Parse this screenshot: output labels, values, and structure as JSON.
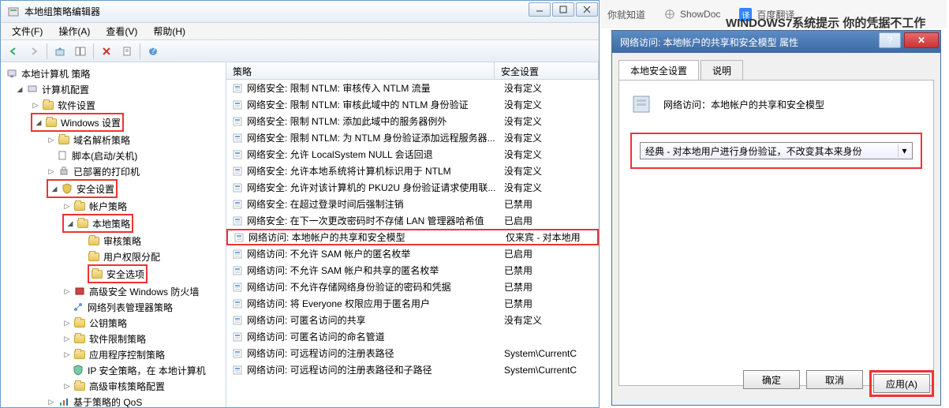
{
  "gpedit": {
    "title": "本地组策略编辑器",
    "menu": {
      "file": "文件(F)",
      "action": "操作(A)",
      "view": "查看(V)",
      "help": "帮助(H)"
    },
    "tree": {
      "root": "本地计算机 策略",
      "computer_config": "计算机配置",
      "software_settings": "软件设置",
      "windows_settings": "Windows 设置",
      "name_resolution": "域名解析策略",
      "scripts": "脚本(启动/关机)",
      "printers": "已部署的打印机",
      "security_settings": "安全设置",
      "account_policy": "帐户策略",
      "local_policy": "本地策略",
      "audit_policy": "审核策略",
      "user_rights": "用户权限分配",
      "security_options": "安全选项",
      "firewall": "高级安全 Windows 防火墙",
      "network_list": "网络列表管理器策略",
      "public_key": "公钥策略",
      "software_restrict": "软件限制策略",
      "app_control": "应用程序控制策略",
      "ip_security": "IP 安全策略，在 本地计算机",
      "audit_config": "高级审核策略配置",
      "qos": "基于策略的 QoS"
    },
    "list": {
      "header_policy": "策略",
      "header_setting": "安全设置",
      "rows": [
        {
          "p": "网络安全: 限制 NTLM: 审核传入 NTLM 流量",
          "s": "没有定义"
        },
        {
          "p": "网络安全: 限制 NTLM: 审核此域中的 NTLM 身份验证",
          "s": "没有定义"
        },
        {
          "p": "网络安全: 限制 NTLM: 添加此域中的服务器例外",
          "s": "没有定义"
        },
        {
          "p": "网络安全: 限制 NTLM: 为 NTLM 身份验证添加远程服务器...",
          "s": "没有定义"
        },
        {
          "p": "网络安全: 允许 LocalSystem NULL 会话回退",
          "s": "没有定义"
        },
        {
          "p": "网络安全: 允许本地系统将计算机标识用于 NTLM",
          "s": "没有定义"
        },
        {
          "p": "网络安全: 允许对该计算机的 PKU2U 身份验证请求使用联...",
          "s": "没有定义"
        },
        {
          "p": "网络安全: 在超过登录时间后强制注销",
          "s": "已禁用"
        },
        {
          "p": "网络安全: 在下一次更改密码时不存储 LAN 管理器哈希值",
          "s": "已启用"
        },
        {
          "p": "网络访问: 本地帐户的共享和安全模型",
          "s": "仅来宾 - 对本地用"
        },
        {
          "p": "网络访问: 不允许 SAM 帐户的匿名枚举",
          "s": "已启用"
        },
        {
          "p": "网络访问: 不允许 SAM 帐户和共享的匿名枚举",
          "s": "已禁用"
        },
        {
          "p": "网络访问: 不允许存储网络身份验证的密码和凭据",
          "s": "已禁用"
        },
        {
          "p": "网络访问: 将 Everyone 权限应用于匿名用户",
          "s": "已禁用"
        },
        {
          "p": "网络访问: 可匿名访问的共享",
          "s": "没有定义"
        },
        {
          "p": "网络访问: 可匿名访问的命名管道",
          "s": ""
        },
        {
          "p": "网络访问: 可远程访问的注册表路径",
          "s": "System\\CurrentC"
        },
        {
          "p": "网络访问: 可远程访问的注册表路径和子路径",
          "s": "System\\CurrentC"
        }
      ]
    }
  },
  "props": {
    "title": "网络访问: 本地帐户的共享和安全模型 属性",
    "tab1": "本地安全设置",
    "tab2": "说明",
    "label": "网络访问：本地帐户的共享和安全模型",
    "select_value": "经典 - 对本地用户进行身份验证，不改变其本来身份",
    "ok": "确定",
    "cancel": "取消",
    "apply": "应用(A)"
  },
  "browser": {
    "tab1": "你就知道",
    "tab2": "ShowDoc",
    "tab3": "百度翻译",
    "headline": "WINDOWS7系统提示 你的凭据不工作"
  }
}
